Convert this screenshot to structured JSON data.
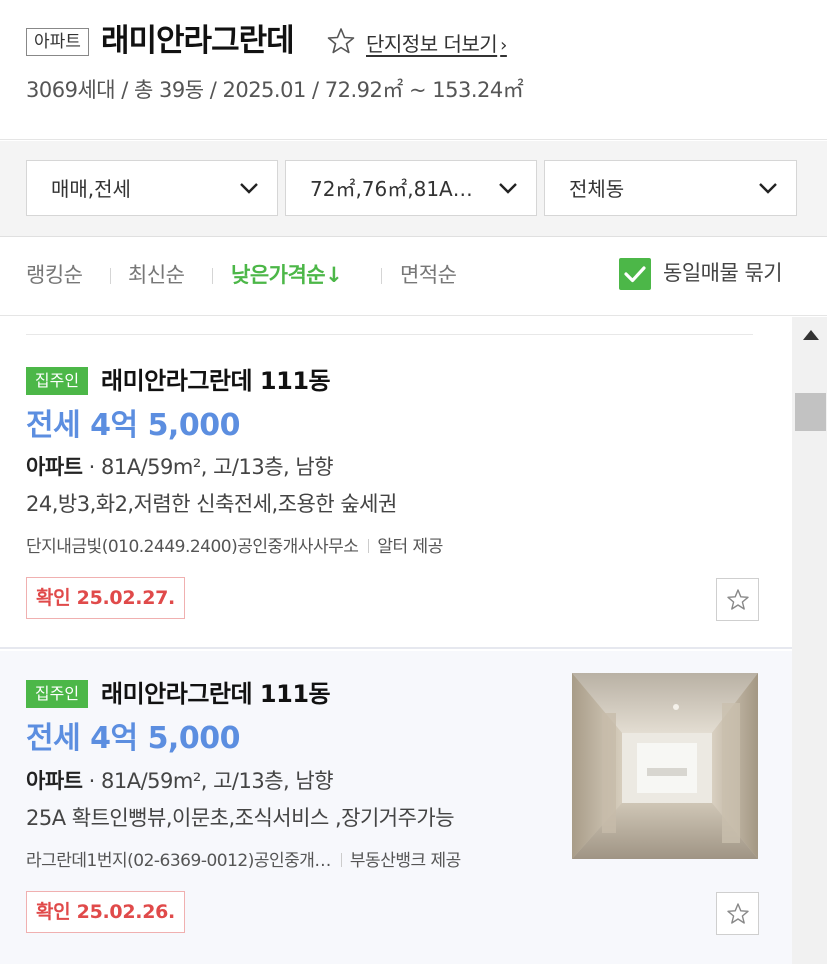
{
  "complex": {
    "type_badge": "아파트",
    "name": "래미안라그란데",
    "more_link": "단지정보 더보기",
    "more_chevron": "›",
    "summary": "3069세대 / 총 39동 / 2025.01 / 72.92㎡ ~ 153.24㎡"
  },
  "filters": {
    "trade": "매매,전세",
    "area": "72㎡,76㎡,81A…",
    "dong": "전체동"
  },
  "sort": {
    "ranking": "랭킹순",
    "latest": "최신순",
    "low_price": "낮은가격순↓",
    "area": "면적순",
    "group_same": "동일매물 묶기"
  },
  "articles": [
    {
      "badge": "집주인",
      "name": "래미안라그란데 111동",
      "price": "전세 4억 5,000",
      "spec_type": "아파트",
      "spec_detail": " · 81A/59m², 고/13층, 남향",
      "desc": "24,방3,화2,저렴한 신축전세,조용한 숲세권",
      "agent": "단지내금빛(010.2449.2400)공인중개사사무소",
      "provider": "알터 제공",
      "confirm": "확인 25.02.27."
    },
    {
      "badge": "집주인",
      "name": "래미안라그란데 111동",
      "price": "전세 4억 5,000",
      "spec_type": "아파트",
      "spec_detail": " · 81A/59m², 고/13층, 남향",
      "desc": "25A 확트인뻥뷰,이문초,조식서비스 ,장기거주가능",
      "agent": "라그란데1번지(02-6369-0012)공인중개…",
      "provider": "부동산뱅크 제공",
      "confirm": "확인 25.02.26."
    }
  ],
  "colors": {
    "accent_green": "#4cb748",
    "price_blue": "#5c8ee0",
    "confirm_red": "#e04a4a"
  },
  "icons": [
    "star-outline-icon",
    "chevron-down-icon",
    "checkbox-checked-icon",
    "scroll-up-arrow-icon"
  ]
}
